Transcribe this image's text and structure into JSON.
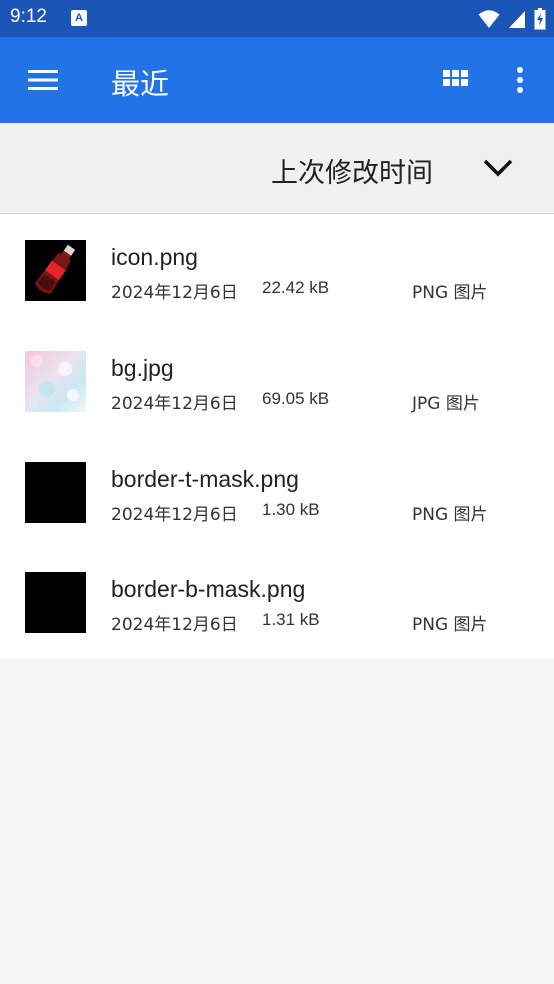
{
  "status_bar": {
    "time": "9:12",
    "notification_icon": "A"
  },
  "app_bar": {
    "title": "最近",
    "menu_icon": "hamburger-menu",
    "view_toggle_icon": "grid-view",
    "more_icon": "more-vert"
  },
  "sort": {
    "label": "上次修改时间",
    "icon": "chevron-down"
  },
  "files": [
    {
      "name": "icon.png",
      "date": "2024年12月6日",
      "size": "22.42 kB",
      "type": "PNG 图片",
      "thumbnail": "red-bottle-image"
    },
    {
      "name": "bg.jpg",
      "date": "2024年12月6日",
      "size": "69.05 kB",
      "type": "JPG 图片",
      "thumbnail": "pastel-bokeh-image"
    },
    {
      "name": "border-t-mask.png",
      "date": "2024年12月6日",
      "size": "1.30 kB",
      "type": "PNG 图片",
      "thumbnail": "black-image"
    },
    {
      "name": "border-b-mask.png",
      "date": "2024年12月6日",
      "size": "1.31 kB",
      "type": "PNG 图片",
      "thumbnail": "black-image"
    }
  ],
  "colors": {
    "status_bar": "#1a55b8",
    "app_bar": "#2173e6",
    "sort_bar": "#f0f0f0",
    "background": "#f5f5f5"
  }
}
